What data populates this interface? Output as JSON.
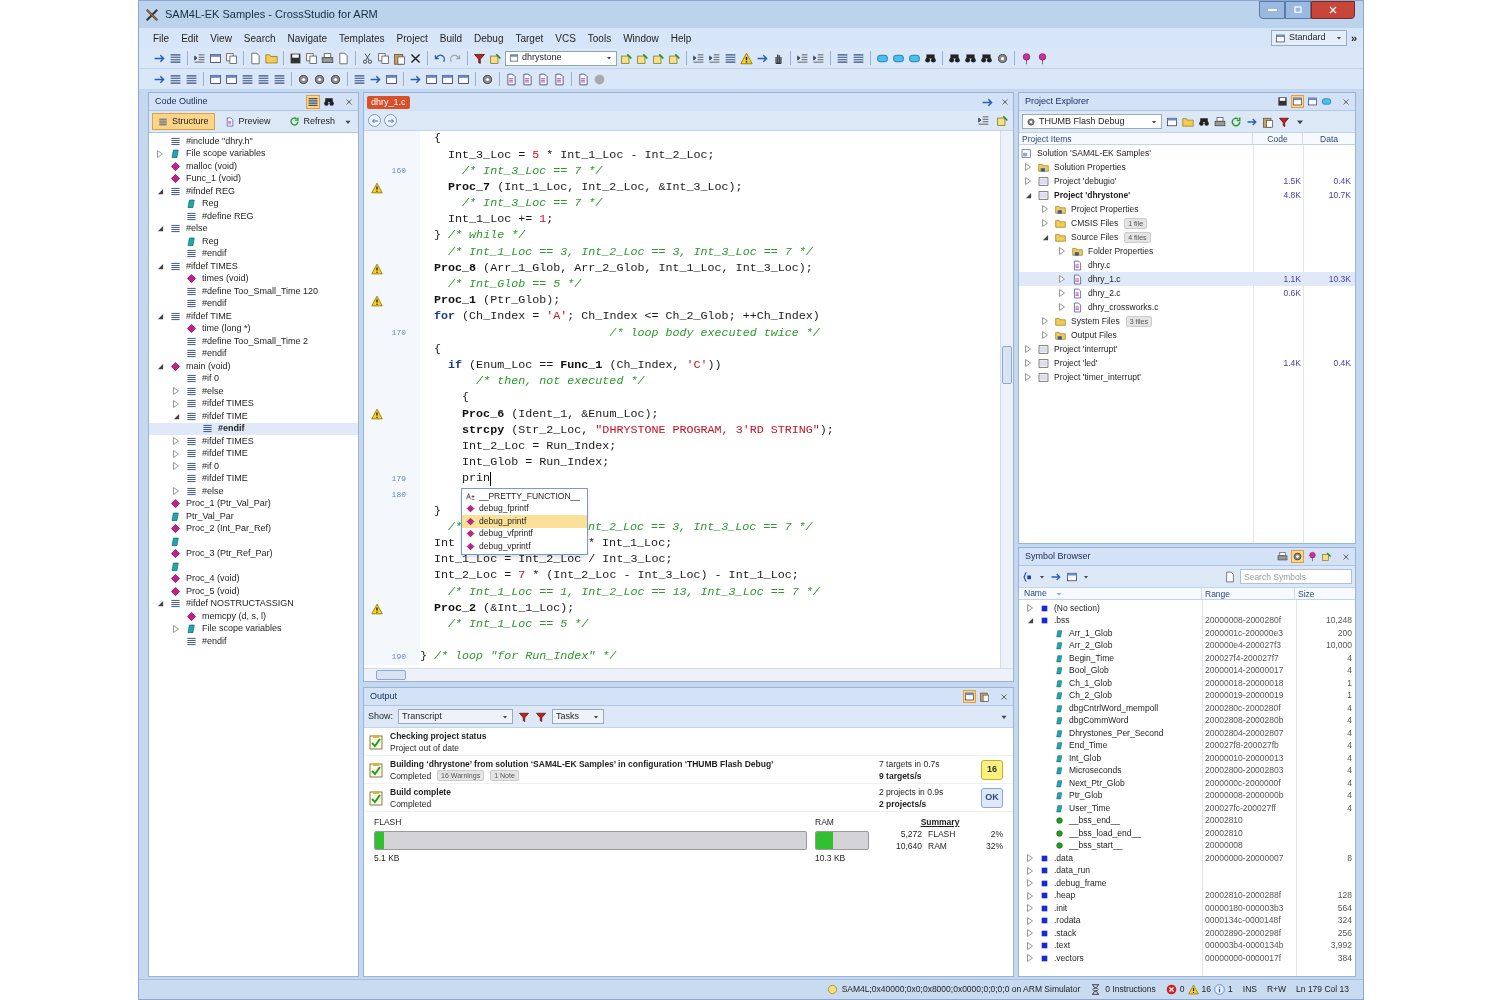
{
  "window": {
    "title": "SAM4L-EK Samples - CrossStudio for ARM"
  },
  "menu": [
    "File",
    "Edit",
    "View",
    "Search",
    "Navigate",
    "Templates",
    "Project",
    "Build",
    "Debug",
    "Target",
    "VCS",
    "Tools",
    "Window",
    "Help"
  ],
  "toolbar": {
    "project_dropdown": "dhrystone",
    "layout_dropdown": "Standard",
    "overflow": "»"
  },
  "code_outline": {
    "title": "Code Outline",
    "view_tabs": [
      {
        "label": "Structure",
        "selected": true
      },
      {
        "label": "Preview",
        "selected": false
      }
    ],
    "refresh": "Refresh",
    "items": [
      {
        "kind": "directive",
        "label": "#include \"dhry.h\"",
        "selected": false
      },
      {
        "kind": "variable",
        "label": "File scope variables",
        "expanded": false,
        "selected": false
      },
      {
        "kind": "function",
        "label": "malloc (void)",
        "selected": false
      },
      {
        "kind": "function",
        "label": "Func_1 (void)",
        "selected": false
      },
      {
        "kind": "directive",
        "label": "#ifndef REG",
        "expanded": true,
        "selected": false,
        "children": [
          {
            "kind": "variable",
            "label": "Reg",
            "selected": false
          },
          {
            "kind": "directive",
            "label": "#define REG",
            "selected": false
          }
        ]
      },
      {
        "kind": "directive",
        "label": "#else",
        "expanded": true,
        "selected": false,
        "children": [
          {
            "kind": "variable",
            "label": "Reg",
            "selected": false
          },
          {
            "kind": "directive",
            "label": "#endif",
            "selected": false
          }
        ]
      },
      {
        "kind": "directive",
        "label": "#ifdef TIMES",
        "expanded": true,
        "selected": false,
        "children": [
          {
            "kind": "function",
            "label": "times (void)",
            "selected": false
          },
          {
            "kind": "directive",
            "label": "#define Too_Small_Time 120",
            "selected": false
          },
          {
            "kind": "directive",
            "label": "#endif",
            "selected": false
          }
        ]
      },
      {
        "kind": "directive",
        "label": "#ifdef TIME",
        "expanded": true,
        "selected": false,
        "children": [
          {
            "kind": "function",
            "label": "time (long *)",
            "selected": false
          },
          {
            "kind": "directive",
            "label": "#define Too_Small_Time 2",
            "selected": false
          },
          {
            "kind": "directive",
            "label": "#endif",
            "selected": false
          }
        ]
      },
      {
        "kind": "function",
        "label": "main (void)",
        "expanded": true,
        "selected": false,
        "children": [
          {
            "kind": "directive",
            "label": "#if 0",
            "selected": false
          },
          {
            "kind": "directive",
            "label": "#else",
            "expanded": false,
            "selected": false
          },
          {
            "kind": "directive",
            "label": "#ifdef TIMES",
            "expanded": false,
            "selected": false
          },
          {
            "kind": "directive",
            "label": "#ifdef TIME",
            "expanded": true,
            "selected": false,
            "children": [
              {
                "kind": "directive",
                "label": "#endif",
                "selected": true
              }
            ]
          },
          {
            "kind": "directive",
            "label": "#ifdef TIMES",
            "expanded": false,
            "selected": false
          },
          {
            "kind": "directive",
            "label": "#ifdef TIME",
            "expanded": false,
            "selected": false
          },
          {
            "kind": "directive",
            "label": "#if 0",
            "expanded": false,
            "selected": false
          },
          {
            "kind": "directive",
            "label": "#ifdef TIME",
            "selected": false
          },
          {
            "kind": "directive",
            "label": "#else",
            "expanded": false,
            "selected": false
          }
        ]
      },
      {
        "kind": "function",
        "label": "Proc_1 (Ptr_Val_Par)",
        "selected": false
      },
      {
        "kind": "variable",
        "label": "Ptr_Val_Par",
        "selected": false
      },
      {
        "kind": "function",
        "label": "Proc_2 (Int_Par_Ref)",
        "selected": false
      },
      {
        "kind": "variable",
        "selected": false
      },
      {
        "kind": "function",
        "label": "Proc_3 (Ptr_Ref_Par)",
        "selected": false
      },
      {
        "kind": "variable",
        "selected": false
      },
      {
        "kind": "function",
        "label": "Proc_4 (void)",
        "selected": false
      },
      {
        "kind": "function",
        "label": "Proc_5 (void)",
        "selected": false
      },
      {
        "kind": "directive",
        "label": "#ifdef NOSTRUCTASSIGN",
        "expanded": true,
        "selected": false,
        "children": [
          {
            "kind": "function",
            "label": "memcpy (d, s, l)",
            "selected": false
          },
          {
            "kind": "variable",
            "label": "File scope variables",
            "expanded": false,
            "selected": false
          },
          {
            "kind": "directive",
            "label": "#endif",
            "selected": false
          }
        ]
      }
    ]
  },
  "editor": {
    "tabs": [
      {
        "label": "dhry_1.c",
        "selected": true
      }
    ],
    "lines": [
      {
        "warning": false,
        "cursor": false,
        "segments": [
          {
            "kind": "code",
            "text": "  {"
          }
        ]
      },
      {
        "warning": false,
        "cursor": false,
        "segments": [
          {
            "kind": "code",
            "text": "    Int_3_Loc = "
          },
          {
            "kind": "number",
            "text": "5"
          },
          {
            "kind": "code",
            "text": " * Int_1_Loc - Int_2_Loc;"
          }
        ]
      },
      {
        "number": "160",
        "warning": false,
        "cursor": false,
        "segments": [
          {
            "kind": "comment",
            "text": "      /* Int_3_Loc == 7 */"
          }
        ]
      },
      {
        "warning": true,
        "cursor": false,
        "segments": [
          {
            "kind": "function",
            "text": "    Proc_7"
          },
          {
            "kind": "code",
            "text": " (Int_1_Loc, Int_2_Loc, &Int_3_Loc);"
          }
        ]
      },
      {
        "warning": false,
        "cursor": false,
        "segments": [
          {
            "kind": "comment",
            "text": "      /* Int_3_Loc == 7 */"
          }
        ]
      },
      {
        "warning": false,
        "cursor": false,
        "segments": [
          {
            "kind": "code",
            "text": "    Int_1_Loc += "
          },
          {
            "kind": "number",
            "text": "1"
          },
          {
            "kind": "code",
            "text": ";"
          }
        ]
      },
      {
        "warning": false,
        "cursor": false,
        "segments": [
          {
            "kind": "code",
            "text": "  } "
          },
          {
            "kind": "comment",
            "text": "/* while */"
          }
        ]
      },
      {
        "warning": false,
        "cursor": false,
        "segments": [
          {
            "kind": "comment",
            "text": "    /* Int_1_Loc == 3, Int_2_Loc == 3, Int_3_Loc == 7 */"
          }
        ]
      },
      {
        "warning": true,
        "cursor": false,
        "segments": [
          {
            "kind": "function",
            "text": "  Proc_8"
          },
          {
            "kind": "code",
            "text": " (Arr_1_Glob, Arr_2_Glob, Int_1_Loc, Int_3_Loc);"
          }
        ]
      },
      {
        "warning": false,
        "cursor": false,
        "segments": [
          {
            "kind": "comment",
            "text": "    /* Int_Glob == 5 */"
          }
        ]
      },
      {
        "warning": true,
        "cursor": false,
        "segments": [
          {
            "kind": "function",
            "text": "  Proc_1"
          },
          {
            "kind": "code",
            "text": " (Ptr_Glob);"
          }
        ]
      },
      {
        "warning": false,
        "cursor": false,
        "segments": [
          {
            "kind": "keyword",
            "text": "  for"
          },
          {
            "kind": "code",
            "text": " (Ch_Index = "
          },
          {
            "kind": "string",
            "text": "'A'"
          },
          {
            "kind": "code",
            "text": "; Ch_Index <= Ch_2_Glob; ++Ch_Index)"
          }
        ]
      },
      {
        "number": "170",
        "warning": false,
        "cursor": false,
        "segments": [
          {
            "kind": "comment",
            "text": "                           /* loop body executed twice */"
          }
        ]
      },
      {
        "warning": false,
        "cursor": false,
        "segments": [
          {
            "kind": "code",
            "text": "  {"
          }
        ]
      },
      {
        "warning": false,
        "cursor": false,
        "segments": [
          {
            "kind": "keyword",
            "text": "    if"
          },
          {
            "kind": "code",
            "text": " (Enum_Loc == "
          },
          {
            "kind": "function",
            "text": "Func_1"
          },
          {
            "kind": "code",
            "text": " (Ch_Index, "
          },
          {
            "kind": "string",
            "text": "'C'"
          },
          {
            "kind": "code",
            "text": "))"
          }
        ]
      },
      {
        "warning": false,
        "cursor": false,
        "segments": [
          {
            "kind": "comment",
            "text": "        /* then, not executed */"
          }
        ]
      },
      {
        "warning": false,
        "cursor": false,
        "segments": [
          {
            "kind": "code",
            "text": "      {"
          }
        ]
      },
      {
        "warning": true,
        "cursor": false,
        "segments": [
          {
            "kind": "function",
            "text": "      Proc_6"
          },
          {
            "kind": "code",
            "text": " (Ident_1, &Enum_Loc);"
          }
        ]
      },
      {
        "warning": false,
        "cursor": false,
        "segments": [
          {
            "kind": "function",
            "text": "      strcpy"
          },
          {
            "kind": "code",
            "text": " (Str_2_Loc, "
          },
          {
            "kind": "string",
            "text": "\"DHRYSTONE PROGRAM, 3'RD STRING\""
          },
          {
            "kind": "code",
            "text": ");"
          }
        ]
      },
      {
        "warning": false,
        "cursor": false,
        "segments": [
          {
            "kind": "code",
            "text": "      Int_2_Loc = Run_Index;"
          }
        ]
      },
      {
        "warning": false,
        "cursor": false,
        "segments": [
          {
            "kind": "code",
            "text": "      Int_Glob = Run_Index;"
          }
        ]
      },
      {
        "number": "179",
        "warning": false,
        "cursor": true,
        "segments": [
          {
            "kind": "code",
            "text": "      prin"
          }
        ]
      },
      {
        "number": "180",
        "warning": false,
        "cursor": false
      },
      {
        "warning": false,
        "cursor": false,
        "segments": [
          {
            "kind": "code",
            "text": "  }"
          }
        ]
      },
      {
        "warning": false,
        "cursor": false,
        "segments": [
          {
            "kind": "comment",
            "text": "    /*"
          }
        ],
        "after_popup": [
          {
            "kind": "comment",
            "text": "nt_2_Loc == 3, Int_3_Loc == 7 */"
          }
        ]
      },
      {
        "warning": false,
        "cursor": false,
        "segments": [
          {
            "kind": "code",
            "text": "  Int"
          }
        ],
        "after_popup": [
          {
            "kind": "code",
            "text": "* Int_1_Loc;"
          }
        ]
      },
      {
        "warning": false,
        "cursor": false,
        "segments": [
          {
            "kind": "code",
            "text": "  Int_1_Loc = Int_2_Loc / Int_3_Loc;"
          }
        ]
      },
      {
        "warning": false,
        "cursor": false,
        "segments": [
          {
            "kind": "code",
            "text": "  Int_2_Loc = "
          },
          {
            "kind": "number",
            "text": "7"
          },
          {
            "kind": "code",
            "text": " * (Int_2_Loc - Int_3_Loc) - Int_1_Loc;"
          }
        ]
      },
      {
        "warning": false,
        "cursor": false,
        "segments": [
          {
            "kind": "comment",
            "text": "    /* Int_1_Loc == 1, Int_2_Loc == 13, Int_3_Loc == 7 */"
          }
        ]
      },
      {
        "warning": true,
        "cursor": false,
        "segments": [
          {
            "kind": "function",
            "text": "  Proc_2"
          },
          {
            "kind": "code",
            "text": " (&Int_1_Loc);"
          }
        ]
      },
      {
        "warning": false,
        "cursor": false,
        "segments": [
          {
            "kind": "comment",
            "text": "    /* Int_1_Loc == 5 */"
          }
        ]
      },
      {
        "warning": false,
        "cursor": false
      },
      {
        "number": "190",
        "warning": false,
        "cursor": false,
        "segments": [
          {
            "kind": "code",
            "text": "} "
          },
          {
            "kind": "comment",
            "text": "/* loop \"for Run_Index\" */"
          }
        ]
      }
    ],
    "completion": [
      {
        "kind": "macro",
        "label": "__PRETTY_FUNCTION__",
        "selected": false
      },
      {
        "kind": "function",
        "label": "debug_fprintf",
        "selected": false
      },
      {
        "kind": "function",
        "label": "debug_printf",
        "selected": true
      },
      {
        "kind": "function",
        "label": "debug_vfprintf",
        "selected": false
      },
      {
        "kind": "function",
        "label": "debug_vprintf",
        "selected": false
      }
    ]
  },
  "project_explorer": {
    "title": "Project Explorer",
    "configuration": "THUMB Flash Debug",
    "columns": [
      "Project Items",
      "Code",
      "Data"
    ],
    "items": [
      {
        "kind": "solution",
        "label": "Solution 'SAM4L-EK Samples'",
        "selected": false,
        "children": [
          {
            "kind": "properties",
            "label": "Solution Properties",
            "expanded": false,
            "selected": false
          },
          {
            "kind": "project",
            "label": "Project 'debugio'",
            "expanded": false,
            "active": false,
            "code": "1.5K",
            "data": "0.4K",
            "selected": false
          },
          {
            "kind": "project",
            "label": "Project 'dhrystone'",
            "expanded": true,
            "active": true,
            "code": "4.8K",
            "data": "10.7K",
            "selected": false,
            "children": [
              {
                "kind": "properties",
                "label": "Project Properties",
                "expanded": false,
                "selected": false
              },
              {
                "kind": "folder",
                "label": "CMSIS Files",
                "badge": "1 file",
                "expanded": false,
                "selected": false
              },
              {
                "kind": "folder",
                "label": "Source Files",
                "badge": "4 files",
                "expanded": true,
                "selected": false,
                "children": [
                  {
                    "kind": "properties",
                    "label": "Folder Properties",
                    "expanded": false,
                    "selected": false
                  },
                  {
                    "kind": "file",
                    "label": "dhry.c",
                    "selected": false
                  },
                  {
                    "kind": "file",
                    "label": "dhry_1.c",
                    "expanded": false,
                    "code": "1.1K",
                    "data": "10.3K",
                    "selected": true
                  },
                  {
                    "kind": "file",
                    "label": "dhry_2.c",
                    "expanded": false,
                    "code": "0.6K",
                    "selected": false
                  },
                  {
                    "kind": "file",
                    "label": "dhry_crossworks.c",
                    "expanded": false,
                    "selected": false
                  }
                ]
              },
              {
                "kind": "folder",
                "label": "System Files",
                "badge": "3 files",
                "expanded": false,
                "selected": false
              },
              {
                "kind": "properties",
                "label": "Output Files",
                "expanded": false,
                "selected": false
              }
            ]
          },
          {
            "kind": "project",
            "label": "Project 'interrupt'",
            "expanded": false,
            "active": false,
            "selected": false
          },
          {
            "kind": "project",
            "label": "Project 'led'",
            "expanded": false,
            "active": false,
            "code": "1.4K",
            "data": "0.4K",
            "selected": false
          },
          {
            "kind": "project",
            "label": "Project 'timer_interrupt'",
            "expanded": false,
            "active": false,
            "selected": false
          }
        ]
      }
    ]
  },
  "symbol_browser": {
    "title": "Symbol Browser",
    "search": {
      "placeholder": "Search Symbols"
    },
    "columns": [
      "Name",
      "Range",
      "Size"
    ],
    "items": [
      {
        "kind": "section",
        "label": "(No section)",
        "expanded": false,
        "selected": false
      },
      {
        "kind": "section",
        "label": ".bss",
        "expanded": true,
        "range": "20000008-2000280f",
        "size": "10,248",
        "selected": false,
        "children": [
          {
            "kind": "variable",
            "label": "Arr_1_Glob",
            "range": "2000001c-200000e3",
            "size": "200",
            "selected": false
          },
          {
            "kind": "variable",
            "label": "Arr_2_Glob",
            "range": "200000e4-200027f3",
            "size": "10,000",
            "selected": false
          },
          {
            "kind": "variable",
            "label": "Begin_Time",
            "range": "200027f4-200027f7",
            "size": "4",
            "selected": false
          },
          {
            "kind": "variable",
            "label": "Bool_Glob",
            "range": "20000014-20000017",
            "size": "4",
            "selected": false
          },
          {
            "kind": "variable",
            "label": "Ch_1_Glob",
            "range": "20000018-20000018",
            "size": "1",
            "selected": false
          },
          {
            "kind": "variable",
            "label": "Ch_2_Glob",
            "range": "20000019-20000019",
            "size": "1",
            "selected": false
          },
          {
            "kind": "variable",
            "label": "dbgCntrlWord_mempoll",
            "range": "2000280c-2000280f",
            "size": "4",
            "selected": false
          },
          {
            "kind": "variable",
            "label": "dbgCommWord",
            "range": "20002808-2000280b",
            "size": "4",
            "selected": false
          },
          {
            "kind": "variable",
            "label": "Dhrystones_Per_Second",
            "range": "20002804-20002807",
            "size": "4",
            "selected": false
          },
          {
            "kind": "variable",
            "label": "End_Time",
            "range": "200027f8-200027fb",
            "size": "4",
            "selected": false
          },
          {
            "kind": "variable",
            "label": "Int_Glob",
            "range": "20000010-20000013",
            "size": "4",
            "selected": false
          },
          {
            "kind": "variable",
            "label": "Microseconds",
            "range": "20002800-20002803",
            "size": "4",
            "selected": false
          },
          {
            "kind": "variable",
            "label": "Next_Ptr_Glob",
            "range": "2000000c-2000000f",
            "size": "4",
            "selected": false
          },
          {
            "kind": "variable",
            "label": "Ptr_Glob",
            "range": "20000008-2000000b",
            "size": "4",
            "selected": false
          },
          {
            "kind": "variable",
            "label": "User_Time",
            "range": "200027fc-200027ff",
            "size": "4",
            "selected": false
          },
          {
            "kind": "label",
            "label": "__bss_end__",
            "range": "20002810",
            "selected": false
          },
          {
            "kind": "label",
            "label": "__bss_load_end__",
            "range": "20002810",
            "selected": false
          },
          {
            "kind": "label",
            "label": "__bss_start__",
            "range": "20000008",
            "selected": false
          }
        ]
      },
      {
        "kind": "section",
        "label": ".data",
        "expanded": false,
        "range": "20000000-20000007",
        "size": "8",
        "selected": false
      },
      {
        "kind": "section",
        "label": ".data_run",
        "expanded": false,
        "selected": false
      },
      {
        "kind": "section",
        "label": ".debug_frame",
        "expanded": false,
        "selected": false
      },
      {
        "kind": "section",
        "label": ".heap",
        "expanded": false,
        "range": "20002810-2000288f",
        "size": "128",
        "selected": false
      },
      {
        "kind": "section",
        "label": ".init",
        "expanded": false,
        "range": "00000180-000003b3",
        "size": "564",
        "selected": false
      },
      {
        "kind": "section",
        "label": ".rodata",
        "expanded": false,
        "range": "0000134c-0000148f",
        "size": "324",
        "selected": false
      },
      {
        "kind": "section",
        "label": ".stack",
        "expanded": false,
        "range": "20002890-2000298f",
        "size": "256",
        "selected": false
      },
      {
        "kind": "section",
        "label": ".text",
        "expanded": false,
        "range": "000003b4-0000134b",
        "size": "3,992",
        "selected": false
      },
      {
        "kind": "section",
        "label": ".vectors",
        "expanded": false,
        "range": "00000000-0000017f",
        "size": "384",
        "selected": false
      }
    ]
  },
  "output": {
    "title": "Output",
    "show_label": "Show:",
    "show": "Transcript",
    "tasks": "Tasks",
    "entries": [
      {
        "title": "Checking project status",
        "detail": "Project out of date"
      },
      {
        "title": "Building ‘dhrystone’ from solution ‘SAM4L-EK Samples’ in configuration ‘THUMB Flash Debug’",
        "detail": "Completed",
        "tags": [
          "16 Warnings",
          "1 Note"
        ],
        "stats": [
          "7 targets in 0.7s",
          "9 targets/s"
        ],
        "badge": {
          "kind": "warning",
          "text": "16"
        }
      },
      {
        "title": "Build complete",
        "detail": "Completed",
        "stats": [
          "2 projects in 0.9s",
          "2 projects/s"
        ],
        "badge": {
          "kind": "ok",
          "text": "OK"
        }
      }
    ],
    "memory": {
      "bars": [
        {
          "label": "FLASH",
          "level": 0.02,
          "reading": "5.1 KB"
        },
        {
          "label": "RAM",
          "level": 0.32,
          "reading": "10.3 KB"
        }
      ],
      "summary": {
        "title": "Summary",
        "rows": [
          [
            "5,272",
            "FLASH",
            "2%"
          ],
          [
            "10,640",
            "RAM",
            "32%"
          ]
        ]
      }
    }
  },
  "status_bar": {
    "target": "SAM4L;0x40000;0x0;0x8000;0x0000;0;0;0;0 on ARM Simulator",
    "instructions": "0 Instructions",
    "errors": "0",
    "warnings": "16",
    "infos": "1",
    "mode": "INS",
    "access": "R+W",
    "position": "Ln 179 Col 13"
  }
}
